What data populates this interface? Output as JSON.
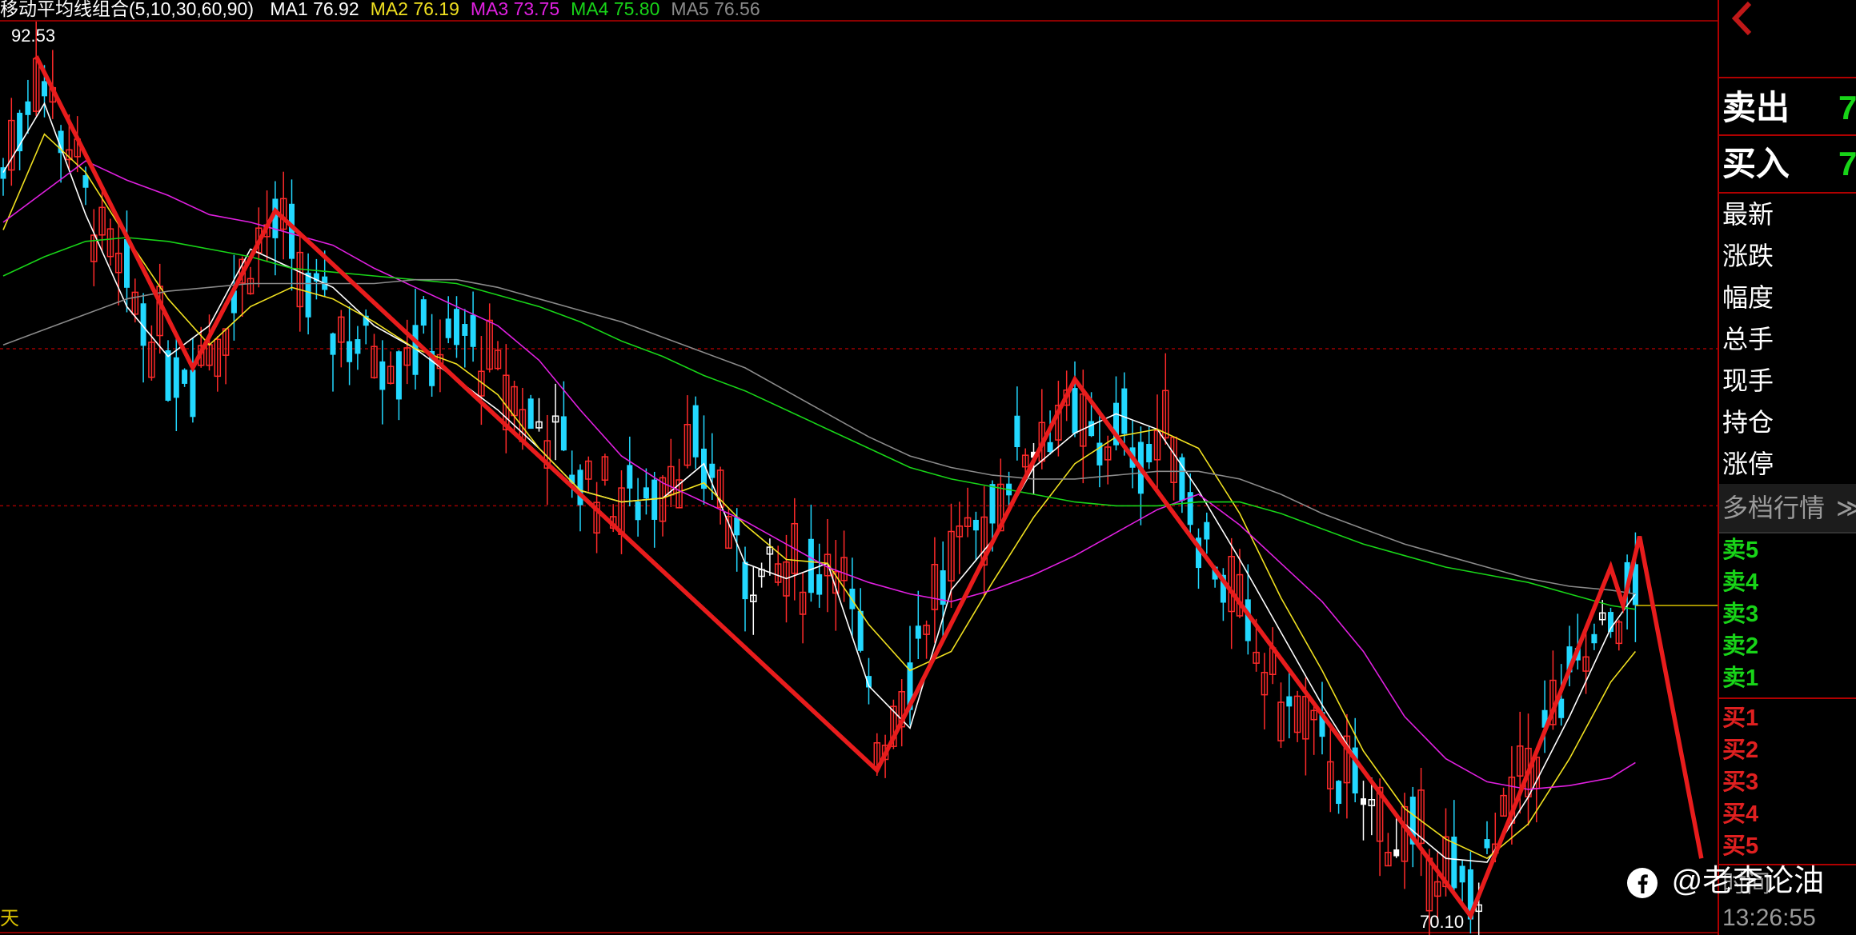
{
  "chart_data": {
    "type": "candlestick",
    "indicator_title": "移动平均线组合(5,10,30,60,90)",
    "ma_legend": [
      {
        "label": "MA1",
        "value": "76.92",
        "color": "#ffffff"
      },
      {
        "label": "MA2",
        "value": "76.19",
        "color": "#f0e020"
      },
      {
        "label": "MA3",
        "value": "73.75",
        "color": "#e020e0"
      },
      {
        "label": "MA4",
        "value": "75.80",
        "color": "#18d418"
      },
      {
        "label": "MA5",
        "value": "76.56",
        "color": "#8a8a8a"
      }
    ],
    "price_high_label": "92.53",
    "price_low_label": "70.10",
    "period_label": "天",
    "y_range": [
      69.6,
      94.0
    ],
    "dashed_levels": [
      84.9,
      80.8
    ],
    "num_bars": 205,
    "zigzag": [
      {
        "x": 4,
        "y": 92.53
      },
      {
        "x": 23,
        "y": 84.4
      },
      {
        "x": 33,
        "y": 88.5
      },
      {
        "x": 106,
        "y": 73.9
      },
      {
        "x": 130,
        "y": 84.1
      },
      {
        "x": 178,
        "y": 70.1
      },
      {
        "x": 195,
        "y": 79.2
      },
      {
        "x": 196.5,
        "y": 78.2
      },
      {
        "x": 198.5,
        "y": 80.0
      },
      {
        "x": 206,
        "y": 71.6
      }
    ],
    "ma_paths": [
      {
        "name": "MA1",
        "color": "#ffffff",
        "points": [
          [
            0,
            89.5
          ],
          [
            5,
            91.3
          ],
          [
            10,
            88.4
          ],
          [
            15,
            86.0
          ],
          [
            20,
            84.7
          ],
          [
            25,
            85.5
          ],
          [
            30,
            87.5
          ],
          [
            35,
            87.0
          ],
          [
            40,
            86.5
          ],
          [
            45,
            85.5
          ],
          [
            50,
            84.9
          ],
          [
            55,
            84.1
          ],
          [
            60,
            83.3
          ],
          [
            65,
            82.3
          ],
          [
            70,
            81.2
          ],
          [
            75,
            80.9
          ],
          [
            80,
            81.0
          ],
          [
            85,
            81.9
          ],
          [
            90,
            79.3
          ],
          [
            95,
            78.9
          ],
          [
            100,
            79.3
          ],
          [
            105,
            76.1
          ],
          [
            110,
            75.0
          ],
          [
            115,
            78.6
          ],
          [
            120,
            79.9
          ],
          [
            125,
            81.8
          ],
          [
            130,
            82.7
          ],
          [
            135,
            83.2
          ],
          [
            140,
            82.8
          ],
          [
            145,
            81.2
          ],
          [
            150,
            79.4
          ],
          [
            155,
            77.5
          ],
          [
            160,
            75.6
          ],
          [
            165,
            73.9
          ],
          [
            170,
            72.5
          ],
          [
            175,
            71.6
          ],
          [
            180,
            71.5
          ],
          [
            185,
            73.2
          ],
          [
            190,
            75.3
          ],
          [
            195,
            77.6
          ],
          [
            198,
            78.5
          ]
        ]
      },
      {
        "name": "MA2",
        "color": "#f0e020",
        "points": [
          [
            0,
            88.0
          ],
          [
            5,
            90.5
          ],
          [
            10,
            89.5
          ],
          [
            15,
            87.8
          ],
          [
            20,
            86.2
          ],
          [
            25,
            85.0
          ],
          [
            30,
            86.0
          ],
          [
            35,
            86.5
          ],
          [
            40,
            86.2
          ],
          [
            45,
            85.6
          ],
          [
            50,
            84.9
          ],
          [
            55,
            84.5
          ],
          [
            60,
            83.7
          ],
          [
            65,
            82.3
          ],
          [
            70,
            81.2
          ],
          [
            75,
            80.9
          ],
          [
            80,
            81.0
          ],
          [
            85,
            81.4
          ],
          [
            90,
            80.3
          ],
          [
            95,
            79.4
          ],
          [
            100,
            79.3
          ],
          [
            105,
            77.7
          ],
          [
            110,
            76.5
          ],
          [
            115,
            77.0
          ],
          [
            120,
            78.8
          ],
          [
            125,
            80.5
          ],
          [
            130,
            81.9
          ],
          [
            135,
            82.6
          ],
          [
            140,
            82.8
          ],
          [
            145,
            82.3
          ],
          [
            150,
            80.6
          ],
          [
            155,
            78.4
          ],
          [
            160,
            76.5
          ],
          [
            165,
            74.4
          ],
          [
            170,
            72.9
          ],
          [
            175,
            72.1
          ],
          [
            180,
            71.6
          ],
          [
            185,
            72.5
          ],
          [
            190,
            74.2
          ],
          [
            195,
            76.2
          ],
          [
            198,
            77.0
          ]
        ]
      },
      {
        "name": "MA3",
        "color": "#e020e0",
        "points": [
          [
            0,
            88.2
          ],
          [
            5,
            89.0
          ],
          [
            10,
            89.8
          ],
          [
            15,
            89.3
          ],
          [
            20,
            88.9
          ],
          [
            25,
            88.4
          ],
          [
            30,
            88.2
          ],
          [
            35,
            87.9
          ],
          [
            40,
            87.6
          ],
          [
            45,
            87.0
          ],
          [
            50,
            86.5
          ],
          [
            55,
            86.0
          ],
          [
            60,
            85.5
          ],
          [
            65,
            84.6
          ],
          [
            70,
            83.3
          ],
          [
            75,
            82.1
          ],
          [
            80,
            81.4
          ],
          [
            85,
            80.9
          ],
          [
            90,
            80.4
          ],
          [
            95,
            79.8
          ],
          [
            100,
            79.2
          ],
          [
            105,
            78.8
          ],
          [
            110,
            78.5
          ],
          [
            115,
            78.3
          ],
          [
            120,
            78.6
          ],
          [
            125,
            79.0
          ],
          [
            130,
            79.5
          ],
          [
            135,
            80.1
          ],
          [
            140,
            80.7
          ],
          [
            145,
            81.1
          ],
          [
            150,
            80.3
          ],
          [
            155,
            79.3
          ],
          [
            160,
            78.3
          ],
          [
            165,
            77.0
          ],
          [
            170,
            75.3
          ],
          [
            175,
            74.2
          ],
          [
            180,
            73.6
          ],
          [
            185,
            73.4
          ],
          [
            190,
            73.5
          ],
          [
            195,
            73.7
          ],
          [
            198,
            74.1
          ]
        ]
      },
      {
        "name": "MA4",
        "color": "#18d418",
        "points": [
          [
            0,
            86.8
          ],
          [
            5,
            87.3
          ],
          [
            10,
            87.7
          ],
          [
            15,
            87.8
          ],
          [
            20,
            87.7
          ],
          [
            25,
            87.5
          ],
          [
            30,
            87.3
          ],
          [
            35,
            87.0
          ],
          [
            40,
            86.9
          ],
          [
            45,
            86.8
          ],
          [
            50,
            86.7
          ],
          [
            55,
            86.6
          ],
          [
            60,
            86.3
          ],
          [
            65,
            86.0
          ],
          [
            70,
            85.6
          ],
          [
            75,
            85.1
          ],
          [
            80,
            84.7
          ],
          [
            85,
            84.2
          ],
          [
            90,
            83.8
          ],
          [
            95,
            83.3
          ],
          [
            100,
            82.8
          ],
          [
            105,
            82.3
          ],
          [
            110,
            81.8
          ],
          [
            115,
            81.5
          ],
          [
            120,
            81.3
          ],
          [
            125,
            81.1
          ],
          [
            130,
            80.9
          ],
          [
            135,
            80.8
          ],
          [
            140,
            80.8
          ],
          [
            145,
            80.9
          ],
          [
            150,
            80.9
          ],
          [
            155,
            80.6
          ],
          [
            160,
            80.2
          ],
          [
            165,
            79.8
          ],
          [
            170,
            79.5
          ],
          [
            175,
            79.2
          ],
          [
            180,
            79.0
          ],
          [
            185,
            78.8
          ],
          [
            190,
            78.5
          ],
          [
            195,
            78.2
          ],
          [
            198,
            78.1
          ]
        ]
      },
      {
        "name": "MA5",
        "color": "#8a8a8a",
        "points": [
          [
            0,
            85.0
          ],
          [
            5,
            85.4
          ],
          [
            10,
            85.8
          ],
          [
            15,
            86.2
          ],
          [
            20,
            86.4
          ],
          [
            25,
            86.5
          ],
          [
            30,
            86.6
          ],
          [
            35,
            86.6
          ],
          [
            40,
            86.6
          ],
          [
            45,
            86.6
          ],
          [
            50,
            86.7
          ],
          [
            55,
            86.7
          ],
          [
            60,
            86.5
          ],
          [
            65,
            86.2
          ],
          [
            70,
            85.9
          ],
          [
            75,
            85.6
          ],
          [
            80,
            85.2
          ],
          [
            85,
            84.8
          ],
          [
            90,
            84.4
          ],
          [
            95,
            83.8
          ],
          [
            100,
            83.2
          ],
          [
            105,
            82.6
          ],
          [
            110,
            82.1
          ],
          [
            115,
            81.8
          ],
          [
            120,
            81.6
          ],
          [
            125,
            81.5
          ],
          [
            130,
            81.5
          ],
          [
            135,
            81.6
          ],
          [
            140,
            81.7
          ],
          [
            145,
            81.7
          ],
          [
            150,
            81.5
          ],
          [
            155,
            81.1
          ],
          [
            160,
            80.6
          ],
          [
            165,
            80.2
          ],
          [
            170,
            79.8
          ],
          [
            175,
            79.5
          ],
          [
            180,
            79.2
          ],
          [
            185,
            78.9
          ],
          [
            190,
            78.7
          ],
          [
            195,
            78.6
          ],
          [
            198,
            78.5
          ]
        ]
      }
    ],
    "candle_anchors": [
      [
        0,
        89.5
      ],
      [
        4,
        92.3
      ],
      [
        8,
        90.2
      ],
      [
        12,
        87.5
      ],
      [
        16,
        86.0
      ],
      [
        20,
        84.8
      ],
      [
        23,
        84.5
      ],
      [
        26,
        85.2
      ],
      [
        30,
        87.2
      ],
      [
        33,
        88.3
      ],
      [
        36,
        86.8
      ],
      [
        40,
        85.5
      ],
      [
        44,
        85.0
      ],
      [
        48,
        84.8
      ],
      [
        50,
        85.3
      ],
      [
        53,
        84.8
      ],
      [
        56,
        85.3
      ],
      [
        60,
        84.0
      ],
      [
        63,
        83.2
      ],
      [
        66,
        82.8
      ],
      [
        69,
        81.8
      ],
      [
        72,
        81.2
      ],
      [
        75,
        80.8
      ],
      [
        78,
        81.2
      ],
      [
        81,
        81.8
      ],
      [
        84,
        82.0
      ],
      [
        86,
        81.9
      ],
      [
        89,
        79.5
      ],
      [
        92,
        78.8
      ],
      [
        95,
        78.9
      ],
      [
        98,
        79.1
      ],
      [
        101,
        79.6
      ],
      [
        104,
        77.0
      ],
      [
        106,
        74.5
      ],
      [
        108,
        75.3
      ],
      [
        111,
        77.5
      ],
      [
        114,
        78.9
      ],
      [
        117,
        79.6
      ],
      [
        120,
        80.9
      ],
      [
        123,
        82.1
      ],
      [
        126,
        82.7
      ],
      [
        128,
        83.1
      ],
      [
        130,
        82.8
      ],
      [
        133,
        82.4
      ],
      [
        136,
        82.7
      ],
      [
        139,
        82.3
      ],
      [
        142,
        82.6
      ],
      [
        145,
        80.3
      ],
      [
        148,
        79.0
      ],
      [
        151,
        77.2
      ],
      [
        154,
        76.0
      ],
      [
        157,
        75.2
      ],
      [
        160,
        74.5
      ],
      [
        163,
        73.6
      ],
      [
        166,
        72.8
      ],
      [
        169,
        72.0
      ],
      [
        172,
        71.9
      ],
      [
        175,
        71.2
      ],
      [
        178,
        70.6
      ],
      [
        181,
        71.7
      ],
      [
        184,
        73.4
      ],
      [
        187,
        74.9
      ],
      [
        190,
        76.1
      ],
      [
        193,
        77.0
      ],
      [
        196,
        78.1
      ],
      [
        198,
        78.6
      ]
    ],
    "candle_colors": {
      "up": "#ff2a2a",
      "down": "#22d8ff",
      "doji": "#ffffff"
    },
    "zigzag_color": "#e81c1c",
    "current_price_line": 78.2
  },
  "side_panel": {
    "sell_label": "卖出",
    "sell_value": "7",
    "buy_label": "买入",
    "buy_value": "7",
    "fields": [
      "最新",
      "涨跌",
      "幅度",
      "总手",
      "现手",
      "持仓",
      "涨停"
    ],
    "depth_title": "多档行情",
    "depth_chevron": "≫",
    "asks": [
      "卖5",
      "卖4",
      "卖3",
      "卖2",
      "卖1"
    ],
    "bids": [
      "买1",
      "买2",
      "买3",
      "买4",
      "买5"
    ],
    "time_label": "时间",
    "time_value": "13:26:55"
  },
  "watermark": {
    "text": "@老李论油"
  }
}
